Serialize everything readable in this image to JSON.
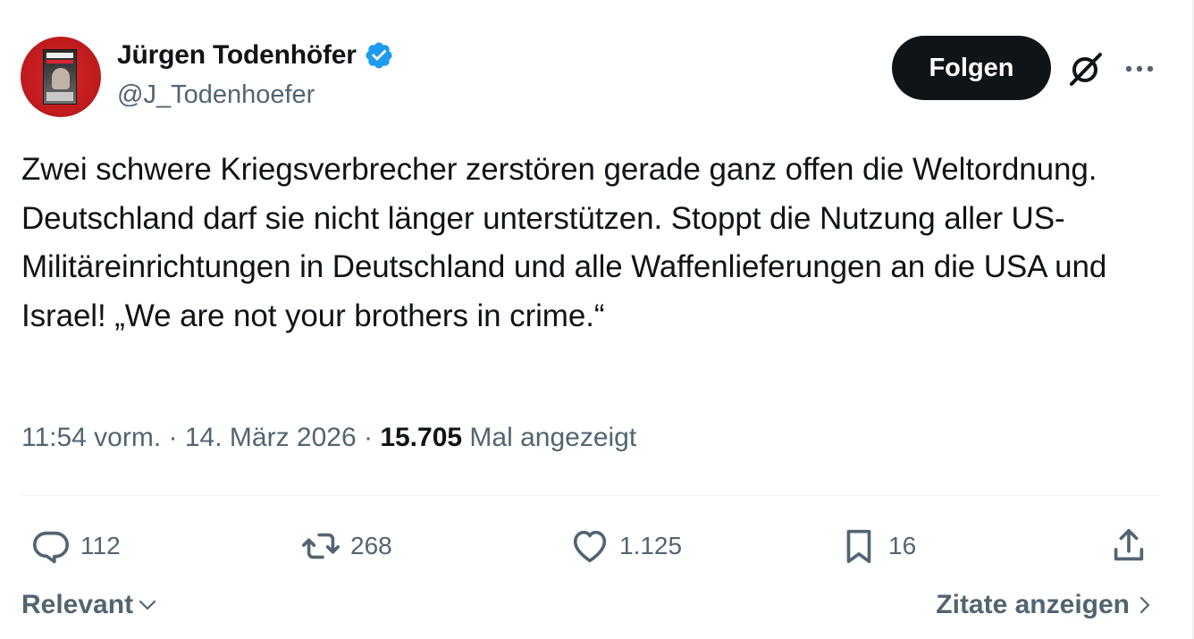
{
  "author": {
    "name": "Jürgen Todenhöfer",
    "handle": "@J_Todenhoefer",
    "verified": true
  },
  "header": {
    "follow_label": "Folgen"
  },
  "tweet": {
    "text": "Zwei schwere Kriegsverbrecher zerstören gerade ganz offen die Weltordnung. Deutschland darf sie nicht länger unterstützen. Stoppt die Nutzung aller US-Militäreinrichtungen in Deutschland und alle Waffenlieferungen an die USA und Israel! „We are not your brothers in crime.“",
    "time": "11:54 vorm.",
    "separator": " · ",
    "date": "14. März 2026",
    "views": "15.705",
    "views_label": " Mal angezeigt"
  },
  "actions": {
    "replies": "112",
    "reposts": "268",
    "likes": "1.125",
    "bookmarks": "16"
  },
  "footer": {
    "sort_label": "Relevant",
    "quotes_label": "Zitate anzeigen"
  },
  "colors": {
    "text_primary": "#0f1419",
    "text_secondary": "#536471",
    "verified_blue": "#1d9bf0",
    "button_dark": "#0f1419",
    "divider": "#eff3f4"
  },
  "icons": [
    "verified-badge-icon",
    "grok-icon",
    "more-icon",
    "reply-icon",
    "repost-icon",
    "like-icon",
    "bookmark-icon",
    "share-icon",
    "chevron-down-icon",
    "chevron-right-icon"
  ]
}
